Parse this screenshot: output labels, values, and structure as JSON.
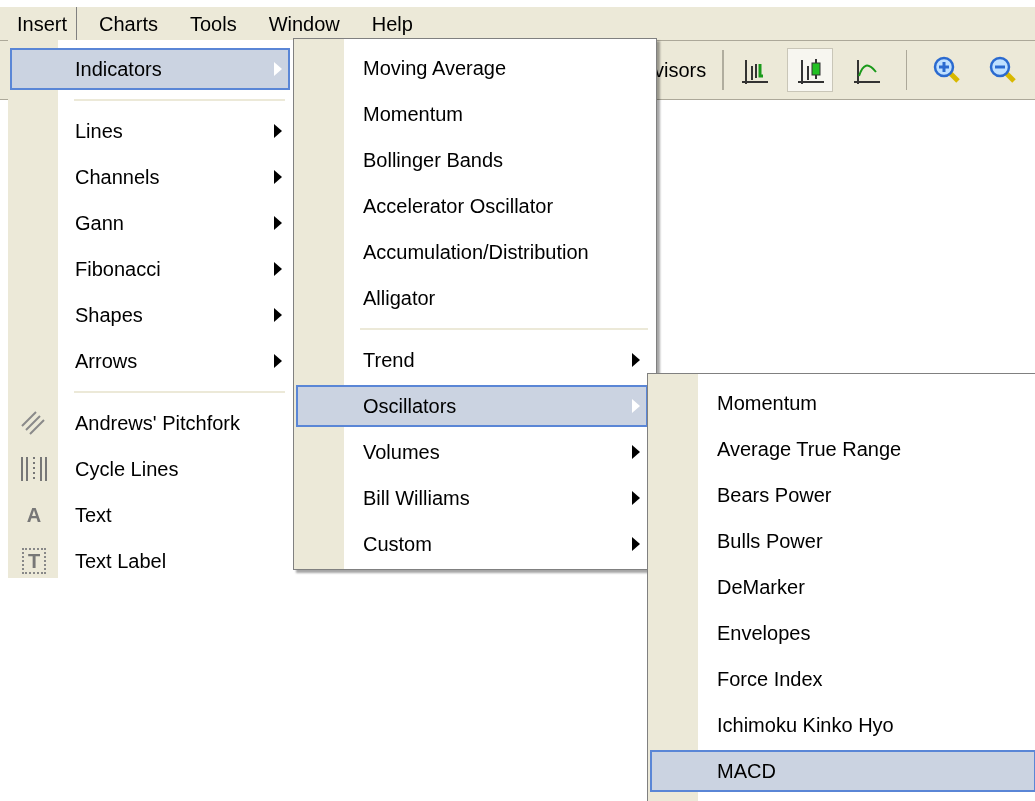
{
  "menubar": [
    {
      "label": "Insert",
      "selected": true
    },
    {
      "label": "Charts",
      "selected": false
    },
    {
      "label": "Tools",
      "selected": false
    },
    {
      "label": "Window",
      "selected": false
    },
    {
      "label": "Help",
      "selected": false
    }
  ],
  "toolbar": {
    "partial_label": "visors",
    "buttons": [
      {
        "kind": "chart",
        "selected": false
      },
      {
        "kind": "chart",
        "selected": true
      },
      {
        "kind": "chart",
        "selected": false
      },
      {
        "kind": "zoom",
        "selected": false
      },
      {
        "kind": "zoom",
        "selected": false
      }
    ]
  },
  "insert_menu": {
    "items": [
      {
        "kind": "submenu",
        "label": "Indicators",
        "selected": true
      },
      {
        "kind": "separator"
      },
      {
        "kind": "submenu",
        "label": "Lines",
        "selected": false
      },
      {
        "kind": "submenu",
        "label": "Channels",
        "selected": false
      },
      {
        "kind": "submenu",
        "label": "Gann",
        "selected": false
      },
      {
        "kind": "submenu",
        "label": "Fibonacci",
        "selected": false
      },
      {
        "kind": "submenu",
        "label": "Shapes",
        "selected": false
      },
      {
        "kind": "submenu",
        "label": "Arrows",
        "selected": false
      },
      {
        "kind": "separator"
      },
      {
        "kind": "tool",
        "label": "Andrews' Pitchfork",
        "selected": false
      },
      {
        "kind": "tool",
        "label": "Cycle Lines",
        "selected": false
      },
      {
        "kind": "tool",
        "label": "Text",
        "selected": false,
        "icon_glyph": "A"
      },
      {
        "kind": "tool",
        "label": "Text Label",
        "selected": false,
        "icon_glyph": "T",
        "icon_frame": true
      }
    ]
  },
  "indicators_menu": {
    "items": [
      {
        "kind": "command",
        "label": "Moving Average",
        "selected": false
      },
      {
        "kind": "command",
        "label": "Momentum",
        "selected": false
      },
      {
        "kind": "command",
        "label": "Bollinger Bands",
        "selected": false
      },
      {
        "kind": "command",
        "label": "Accelerator Oscillator",
        "selected": false
      },
      {
        "kind": "command",
        "label": "Accumulation/Distribution",
        "selected": false
      },
      {
        "kind": "command",
        "label": "Alligator",
        "selected": false
      },
      {
        "kind": "separator"
      },
      {
        "kind": "submenu",
        "label": "Trend",
        "selected": false
      },
      {
        "kind": "submenu",
        "label": "Oscillators",
        "selected": true
      },
      {
        "kind": "submenu",
        "label": "Volumes",
        "selected": false
      },
      {
        "kind": "submenu",
        "label": "Bill Williams",
        "selected": false
      },
      {
        "kind": "submenu",
        "label": "Custom",
        "selected": false
      }
    ]
  },
  "oscillators_menu": {
    "items": [
      {
        "kind": "command",
        "label": "Momentum",
        "selected": false
      },
      {
        "kind": "command",
        "label": "Average True Range",
        "selected": false
      },
      {
        "kind": "command",
        "label": "Bears Power",
        "selected": false
      },
      {
        "kind": "command",
        "label": "Bulls Power",
        "selected": false
      },
      {
        "kind": "command",
        "label": "DeMarker",
        "selected": false
      },
      {
        "kind": "command",
        "label": "Envelopes",
        "selected": false
      },
      {
        "kind": "command",
        "label": "Force Index",
        "selected": false
      },
      {
        "kind": "command",
        "label": "Ichimoku Kinko Hyo",
        "selected": false
      },
      {
        "kind": "command",
        "label": "MACD",
        "selected": true
      }
    ]
  }
}
